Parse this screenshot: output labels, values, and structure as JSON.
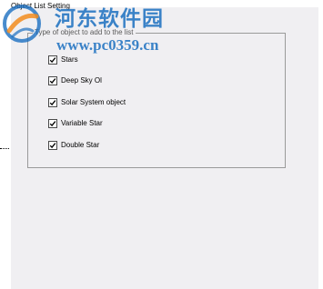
{
  "window": {
    "title": "Object List Setting"
  },
  "group": {
    "legend": "Type of object to add to the list"
  },
  "options": [
    {
      "label": "Stars",
      "checked": true
    },
    {
      "label": "Deep Sky Ol",
      "checked": true
    },
    {
      "label": "Solar System object",
      "checked": true
    },
    {
      "label": "Variable Star",
      "checked": true
    },
    {
      "label": "Double Star",
      "checked": true
    }
  ],
  "watermark": {
    "line1": "河东软件园",
    "line2": "www.pc0359.cn",
    "color": "#1b6fc0"
  }
}
